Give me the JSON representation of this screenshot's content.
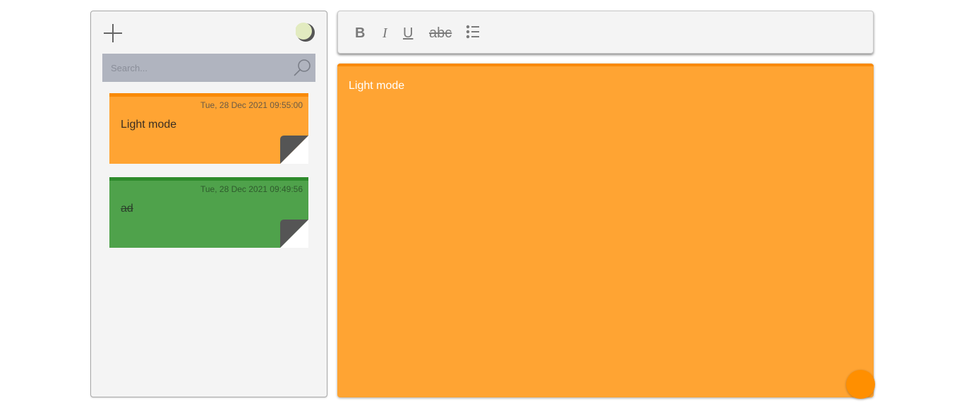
{
  "sidebar": {
    "add_icon": "plus-icon",
    "theme_icon": "moon-icon",
    "search": {
      "placeholder": "Search...",
      "value": "",
      "icon": "search-icon"
    },
    "notes": [
      {
        "date": "Tue, 28 Dec 2021 09:55:00",
        "title": "Light mode",
        "color": "#ffa433",
        "accent": "#f98a07",
        "strikethrough": false
      },
      {
        "date": "Tue, 28 Dec 2021 09:49:56",
        "title": "ad",
        "color": "#4fa24b",
        "accent": "#2e8b2c",
        "strikethrough": true
      }
    ]
  },
  "toolbar": {
    "bold_label": "B",
    "italic_label": "I",
    "underline_label": "U",
    "strike_label": "abc",
    "list_icon": "bulleted-list-icon"
  },
  "editor": {
    "content": "Light mode",
    "background": "#ffa433",
    "accent": "#f98a07"
  },
  "color_picker": {
    "color": "#ff8f00"
  }
}
